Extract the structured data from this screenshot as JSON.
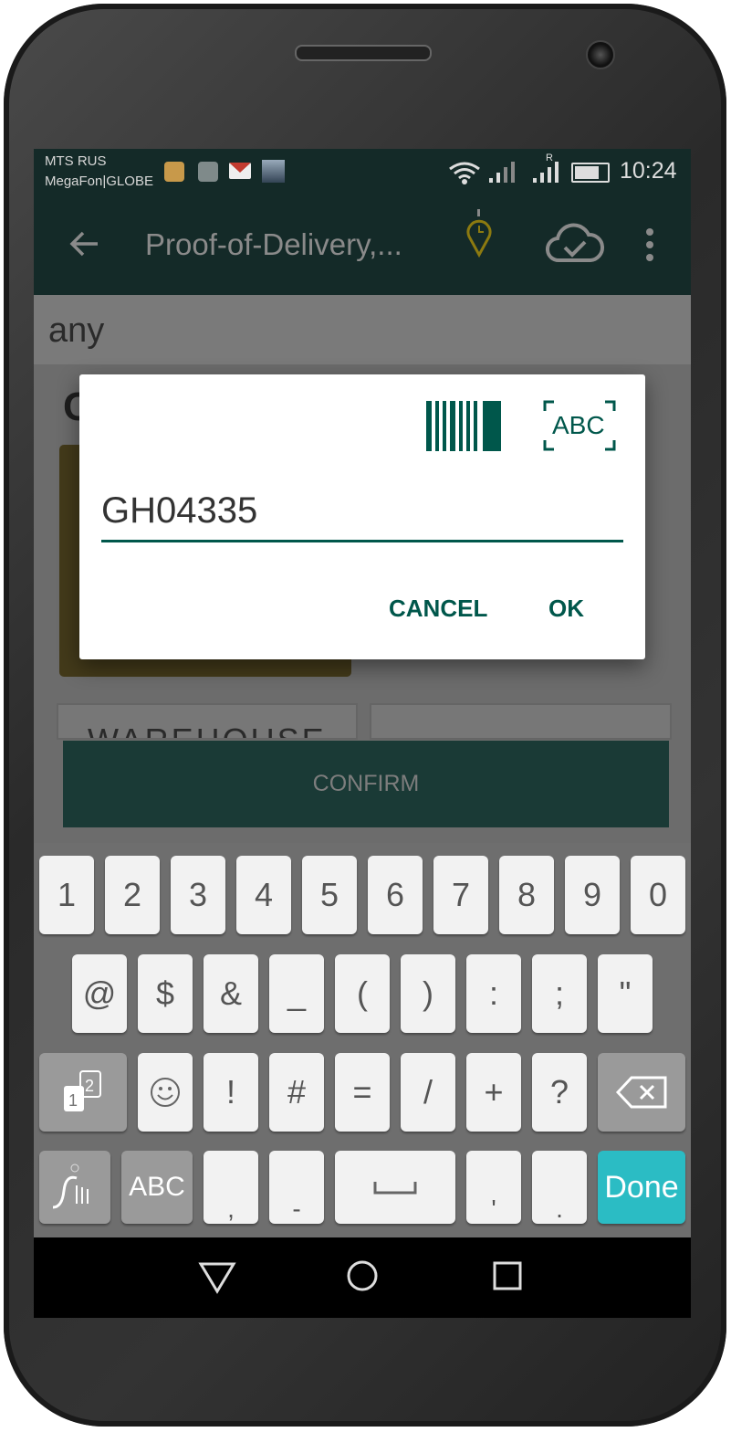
{
  "status_bar": {
    "carrier_1": "MTS RUS",
    "carrier_2": "MegaFon|GLOBE",
    "notification_icons": [
      "keyboard-icon",
      "gallery-icon",
      "gmail-icon",
      "ship-photo-icon"
    ],
    "roaming_indicator": "R",
    "time": "10:24"
  },
  "app_bar": {
    "title": "Proof-of-Delivery,...",
    "icons": [
      "back-arrow-icon",
      "location-clock-icon",
      "cloud-check-icon",
      "more-vert-icon"
    ],
    "color": "#00574b"
  },
  "background": {
    "any_label": "any",
    "heading_partial": "C",
    "warehouse_label": "WAREHOUSE",
    "confirm_label": "CONFIRM"
  },
  "dialog": {
    "barcode_icon": "barcode-icon",
    "ocr_label": "ABC",
    "input_value": "GH04335",
    "cancel_label": "CANCEL",
    "ok_label": "OK",
    "accent": "#00574b"
  },
  "keyboard": {
    "row1": [
      "1",
      "2",
      "3",
      "4",
      "5",
      "6",
      "7",
      "8",
      "9",
      "0"
    ],
    "row2": [
      "@",
      "$",
      "&",
      "_",
      "(",
      ")",
      ":",
      ";",
      "\""
    ],
    "row3": [
      "!",
      "#",
      "=",
      "/",
      "+",
      "?"
    ],
    "abc_label": "ABC",
    "done_label": "Done",
    "row4_punct": [
      ",",
      "-",
      "'",
      "."
    ],
    "done_color": "#2bbcc4"
  },
  "nav_bar": {
    "icons": [
      "back-triangle-icon",
      "home-circle-icon",
      "recents-square-icon"
    ]
  }
}
